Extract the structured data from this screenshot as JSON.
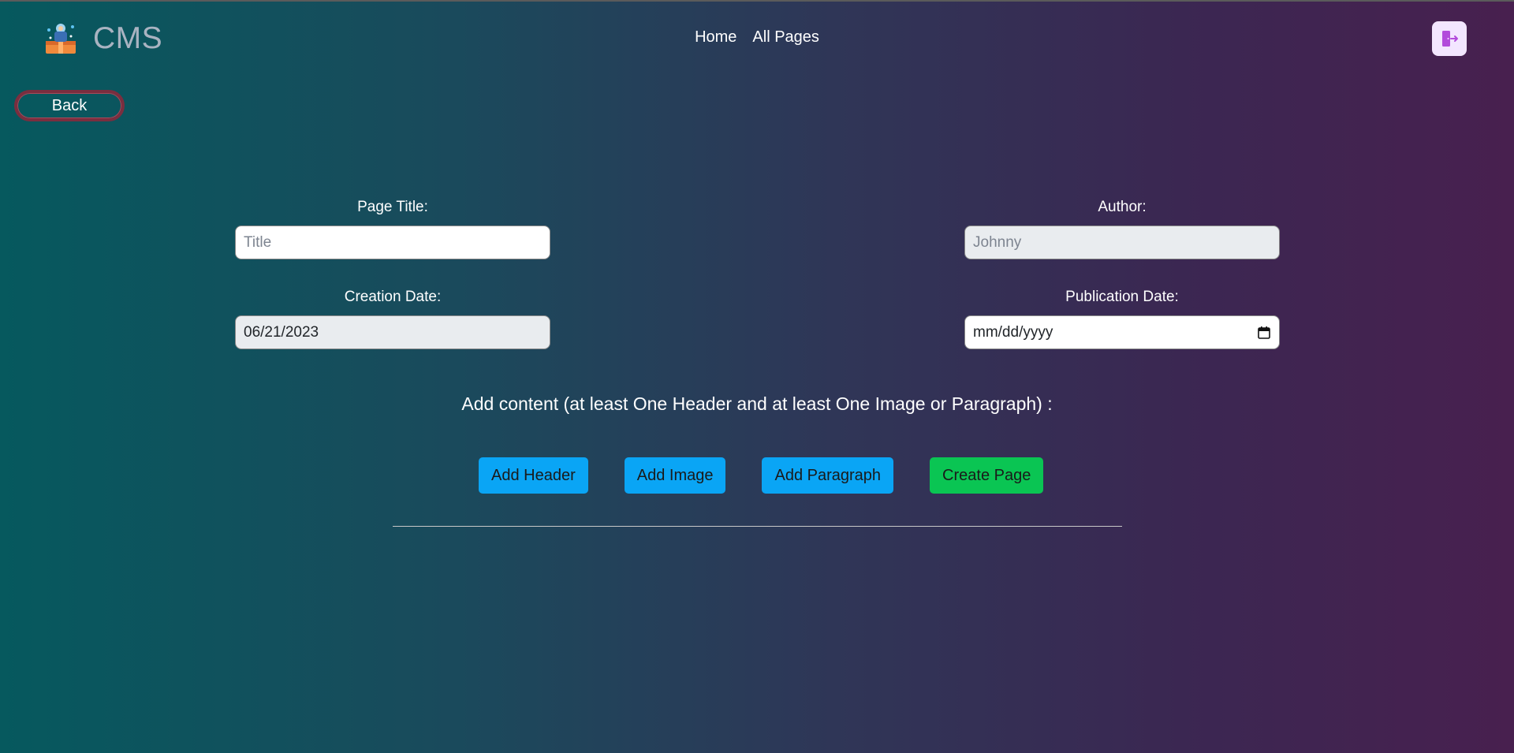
{
  "brand": {
    "name": "CMS"
  },
  "nav": {
    "home": "Home",
    "all_pages": "All Pages"
  },
  "back": {
    "label": "Back"
  },
  "form": {
    "title": {
      "label": "Page Title:",
      "placeholder": "Title",
      "value": ""
    },
    "author": {
      "label": "Author:",
      "value": "Johnny",
      "disabled": true
    },
    "creation_date": {
      "label": "Creation Date:",
      "value": "06/21/2023",
      "disabled": true
    },
    "publication_date": {
      "label": "Publication Date:",
      "placeholder": "mm/dd/yyyy"
    }
  },
  "instruction": "Add content (at least One Header and at least One Image or Paragraph) :",
  "actions": {
    "add_header": "Add Header",
    "add_image": "Add Image",
    "add_paragraph": "Add Paragraph",
    "create_page": "Create Page"
  },
  "colors": {
    "primary_button": "#0aa5f5",
    "success_button": "#0ac553",
    "back_border": "#7a2e3f",
    "logout_bg": "#f3e6ff"
  },
  "icons": {
    "logo": "cms-logo-icon",
    "logout": "logout-icon",
    "calendar": "calendar-icon"
  }
}
